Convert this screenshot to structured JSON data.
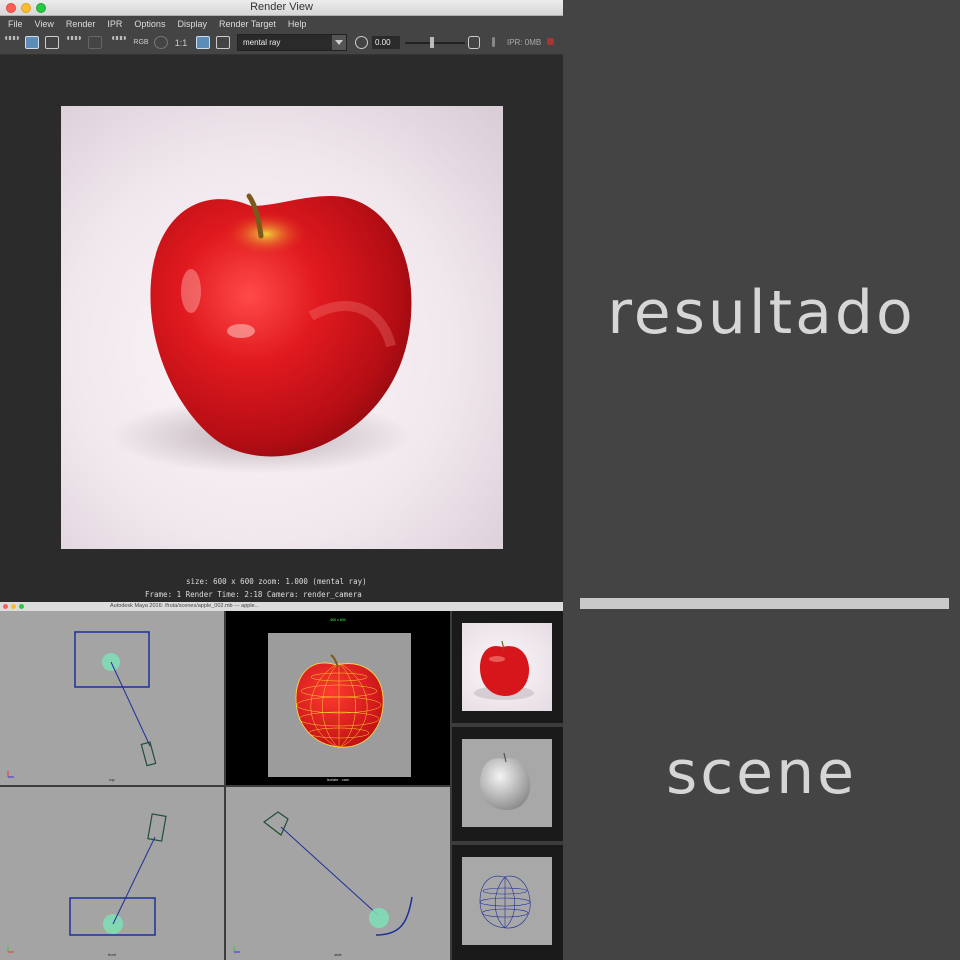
{
  "window": {
    "title": "Render View"
  },
  "menu": [
    "File",
    "View",
    "Render",
    "IPR",
    "Options",
    "Display",
    "Render Target",
    "Help"
  ],
  "toolbar": {
    "rgb_label": "RGB",
    "ratio_label": "1:1",
    "renderer": "mental ray",
    "exposure": "0.00",
    "ipr_memory": "IPR: 0MB"
  },
  "render_status": {
    "line1": "size:  600 x 600  zoom: 1.000      (mental ray)",
    "line2": "Frame: 1      Render Time: 2:18      Camera: render_camera"
  },
  "maya": {
    "title": "Autodesk Maya 2016: /fruta/scenes/apple_002.mb  ---  apple...",
    "viewports": {
      "top": "top",
      "persp": "Isolate : cam",
      "front": "front",
      "side": "side"
    },
    "persp_header": "600 x 600"
  },
  "labels": {
    "result": "resultado",
    "scene": "scene"
  },
  "colors": {
    "apple_red": "#d8141a",
    "camera_blue": "#1f2f9a",
    "light_green": "#7fe0b8"
  }
}
